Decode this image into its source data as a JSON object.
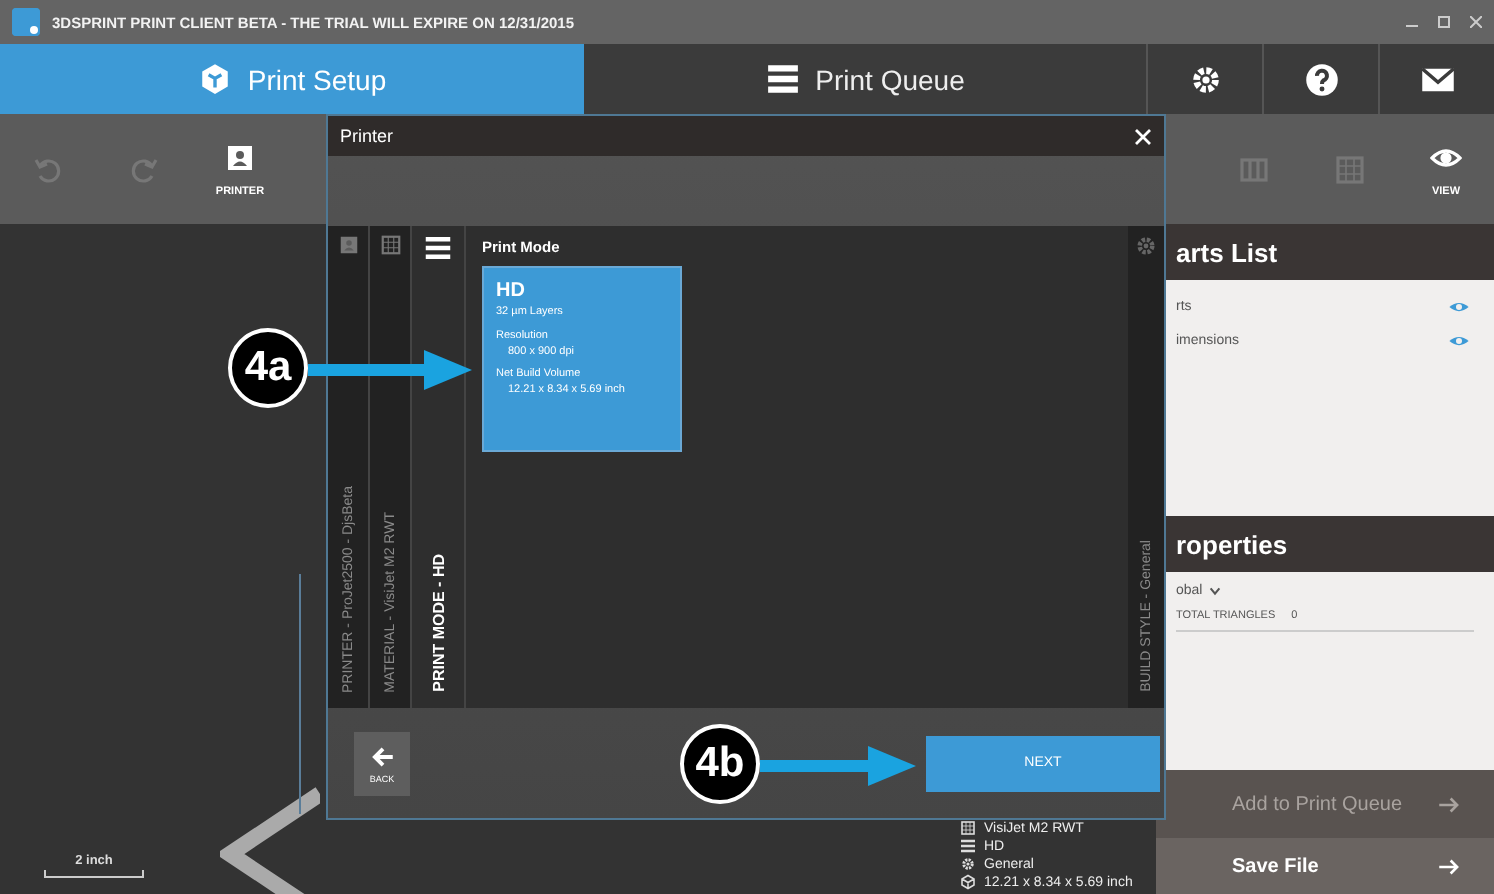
{
  "window": {
    "title": "3DSPRINT PRINT CLIENT BETA - THE TRIAL WILL EXPIRE ON 12/31/2015"
  },
  "nav_tabs": [
    {
      "label": "Print Setup",
      "kind": "setup",
      "selected": true
    },
    {
      "label": "Print Queue",
      "kind": "queue",
      "selected": false
    }
  ],
  "toolbar_left": [
    {
      "kind": "undo",
      "disabled": true
    },
    {
      "kind": "redo",
      "disabled": true
    },
    {
      "kind": "printer",
      "label": "PRINTER",
      "disabled": false
    }
  ],
  "toolbar_right": [
    {
      "kind": "layers",
      "disabled": true
    },
    {
      "kind": "grid",
      "disabled": true
    },
    {
      "kind": "view",
      "label": "VIEW",
      "disabled": false
    }
  ],
  "dialog": {
    "title": "Printer",
    "steps": [
      {
        "kind": "printer",
        "label": "PRINTER - ProJet2500 - DjsBeta",
        "selected": false
      },
      {
        "kind": "material",
        "label": "MATERIAL - VisiJet M2 RWT",
        "selected": false
      },
      {
        "kind": "mode",
        "label": "PRINT MODE - HD",
        "selected": true
      }
    ],
    "section_title": "Print Mode",
    "modes": [
      {
        "title": "HD",
        "layers": "32 µm Layers",
        "resolution_label": "Resolution",
        "resolution": "800 x 900 dpi",
        "volume_label": "Net Build Volume",
        "volume": "12.21 x 8.34 x 5.69 inch",
        "selected": true
      }
    ],
    "build_style": "BUILD STYLE - General",
    "back": "BACK",
    "next": "NEXT"
  },
  "parts_panel": {
    "title": "arts List",
    "items": [
      {
        "name": "rts",
        "visible": true
      },
      {
        "name": "imensions",
        "visible": true
      }
    ],
    "properties_title": "roperties",
    "scope": "obal",
    "property_label": "TOTAL TRIANGLES",
    "property_value": "0",
    "add_button": {
      "label": "Add to Print Queue",
      "disabled": true
    },
    "save_button": {
      "label": "Save File",
      "disabled": false
    }
  },
  "summary": [
    {
      "kind": "material",
      "text": "VisiJet M2 RWT"
    },
    {
      "kind": "mode",
      "text": "HD"
    },
    {
      "kind": "style",
      "text": "General"
    },
    {
      "kind": "volume",
      "text": "12.21 x 8.34 x 5.69 inch"
    }
  ],
  "scale_label": "2 inch",
  "callouts": [
    {
      "label": "4a"
    },
    {
      "label": "4b"
    }
  ]
}
